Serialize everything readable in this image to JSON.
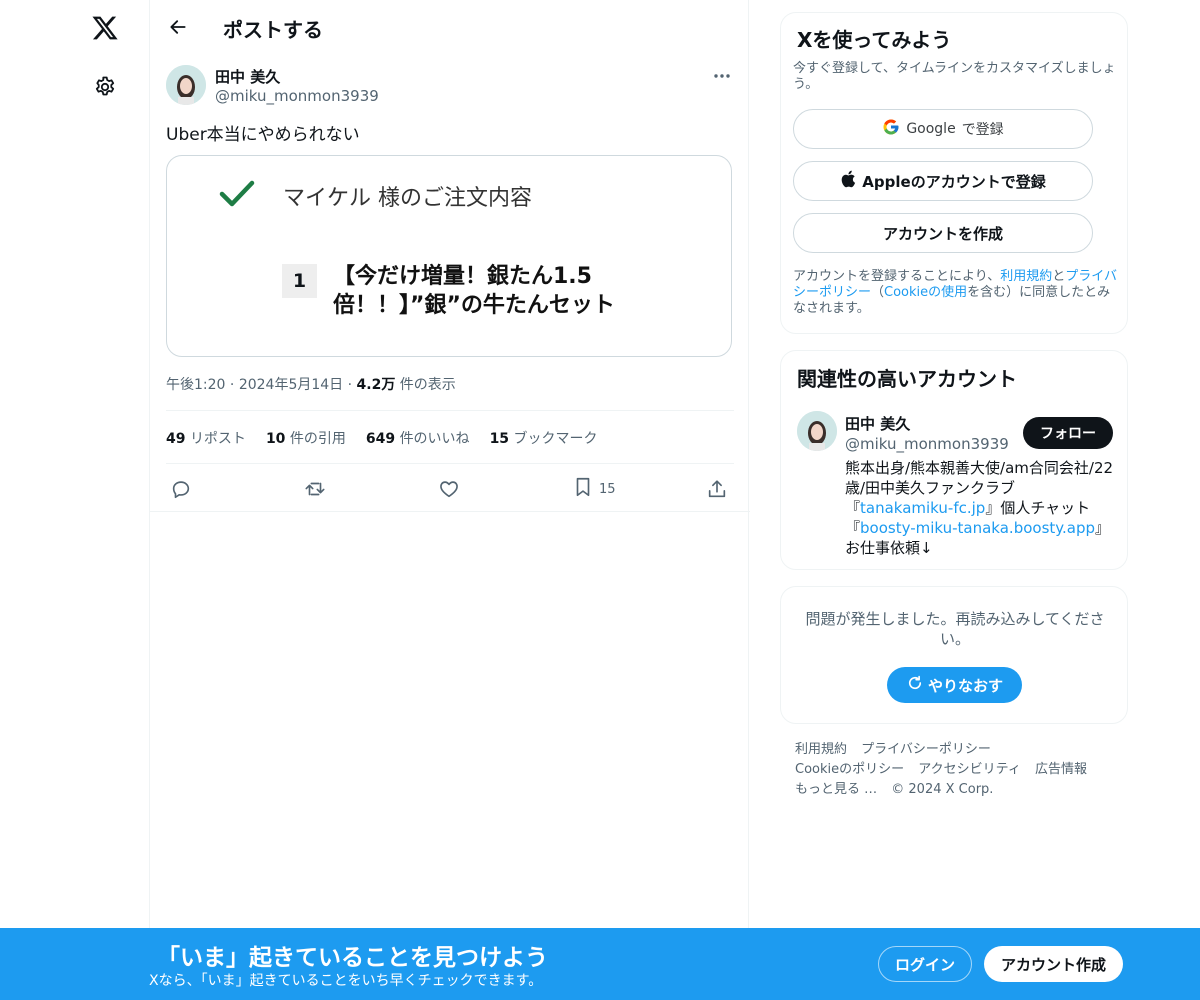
{
  "nav": {
    "logo_icon": "x-logo-icon",
    "settings_icon": "gear-icon"
  },
  "header": {
    "title": "ポストする"
  },
  "post": {
    "author_name": "田中 美久",
    "author_handle": "@miku_monmon3939",
    "text": "Uber本当にやめられない",
    "media": {
      "order_title": "マイケル 様のご注文内容",
      "quantity": "1",
      "item_name": "【今だけ増量！銀たん1.5倍！！】”銀”の牛たんセット"
    },
    "time": "午後1:20",
    "date": "2024年5月14日",
    "views_count": "4.2万",
    "views_label": "件の表示",
    "stats": {
      "reposts_count": "49",
      "reposts_label": "リポスト",
      "quotes_count": "10",
      "quotes_label": "件の引用",
      "likes_count": "649",
      "likes_label": "件のいいね",
      "bookmarks_count": "15",
      "bookmarks_label": "ブックマーク"
    },
    "bookmark_action_count": "15"
  },
  "signup_card": {
    "title": "Xを使ってみよう",
    "subtitle": "今すぐ登録して、タイムラインをカスタマイズしましょう。",
    "google_brand": "Google",
    "google_suffix": "で登録",
    "apple_label": "Appleのアカウントで登録",
    "create_label": "アカウントを作成",
    "terms_prefix": "アカウントを登録することにより、",
    "terms_link": "利用規約",
    "terms_and": "と",
    "privacy_link": "プライバシーポリシー",
    "terms_paren_open": "（",
    "cookie_link": "Cookieの使用",
    "terms_paren_close": "を含む）に同意したとみなされます。"
  },
  "related_card": {
    "title": "関連性の高いアカウント",
    "name": "田中 美久",
    "handle": "@miku_monmon3939",
    "follow_label": "フォロー",
    "bio_1": "熊本出身/熊本親善大使/am合同会社/22歳/田中美久ファンクラブ『",
    "bio_link_1": "tanakamiku-fc.jp",
    "bio_2": "』個人チャット『",
    "bio_link_2": "boosty-miku-tanaka.boosty.app",
    "bio_3": "』お仕事依頼↓"
  },
  "error_card": {
    "message": "問題が発生しました。再読み込みしてください。",
    "retry_label": "やりなおす"
  },
  "footer": {
    "terms": "利用規約",
    "privacy": "プライバシーポリシー",
    "cookie": "Cookieのポリシー",
    "accessibility": "アクセシビリティ",
    "ads": "広告情報",
    "more": "もっと見る …",
    "copyright": "© 2024 X Corp."
  },
  "bottom_bar": {
    "title": "「いま」起きていることを見つけよう",
    "subtitle": "Xなら、「いま」起きていることをいち早くチェックできます。",
    "login_label": "ログイン",
    "signup_label": "アカウント作成"
  },
  "colors": {
    "accent": "#1d9bf0",
    "text": "#0f1419",
    "muted": "#536471",
    "border": "#eff3f4"
  }
}
